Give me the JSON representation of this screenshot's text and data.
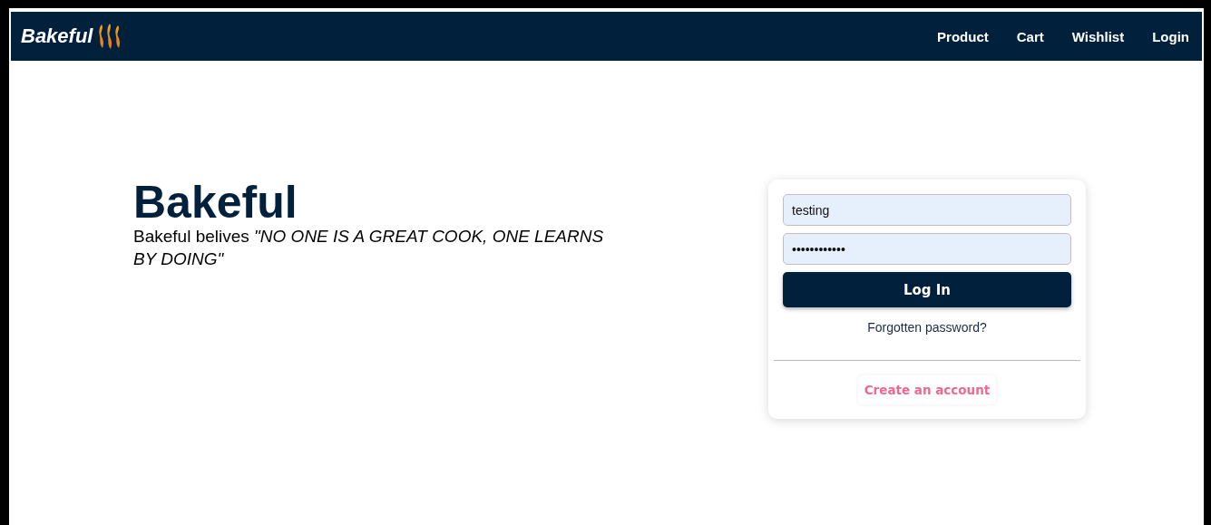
{
  "navbar": {
    "brand": "Bakeful",
    "links": [
      "Product",
      "Cart",
      "Wishlist",
      "Login"
    ]
  },
  "hero": {
    "title": "Bakeful",
    "tagline": "Bakeful belives *\"NO ONE IS A GREAT COOK, ONE LEARNS BY DOING\"*"
  },
  "login_form": {
    "username": {
      "value": "testing"
    },
    "password": {
      "value": "••••••••••••"
    },
    "submit": "Log In",
    "forgot_link": "Forgotten password?",
    "create_account": "Create an account"
  }
}
